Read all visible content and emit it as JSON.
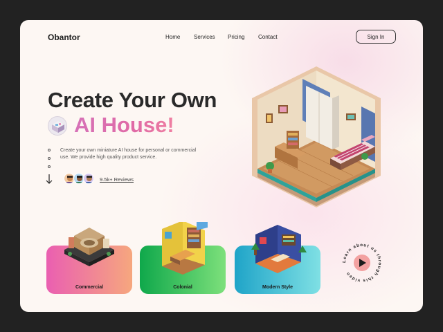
{
  "brand": {
    "name": "Obantor"
  },
  "nav": {
    "items": [
      {
        "label": "Home"
      },
      {
        "label": "Services"
      },
      {
        "label": "Pricing"
      },
      {
        "label": "Contact"
      }
    ],
    "signin_label": "Sign In"
  },
  "hero": {
    "title_line1": "Create Your Own",
    "title_line2": "AI House!",
    "description": "Create your own miniature AI house for personal or commercial use. We provide high quality product service.",
    "reviews_label": "9.5k+ Reviews"
  },
  "categories": [
    {
      "label": "Commercial"
    },
    {
      "label": "Colonial"
    },
    {
      "label": "Modern Style"
    }
  ],
  "video_cta": {
    "text": "Learn about us through this video"
  },
  "colors": {
    "background": "#222222",
    "card": "#fdf7f3",
    "title_gradient_start": "#d671b8",
    "title_gradient_end": "#ef7fa1",
    "commercial": "#ea5fb1",
    "colonial": "#0fa84b",
    "modern": "#1fa4c8",
    "play": "#f08a8a"
  },
  "icons": [
    "arrow-down-icon",
    "play-icon"
  ]
}
